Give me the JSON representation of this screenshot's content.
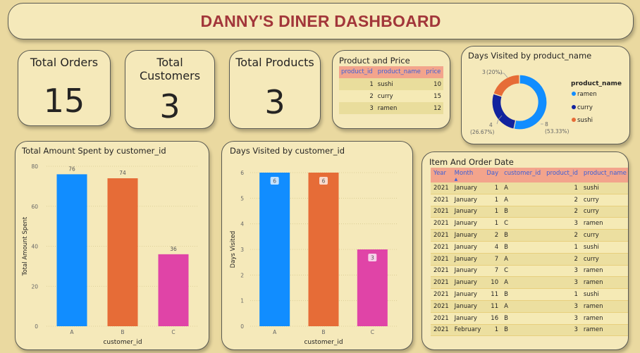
{
  "title": "DANNY'S DINER DASHBOARD",
  "kpis": {
    "orders": {
      "label": "Total Orders",
      "value": "15"
    },
    "customers": {
      "label_line1": "Total",
      "label_line2": "Customers",
      "value": "3"
    },
    "products": {
      "label": "Total Products",
      "value": "3"
    }
  },
  "product_price": {
    "title": "Product and Price",
    "headers": [
      "product_id",
      "product_name",
      "price"
    ],
    "rows": [
      [
        "1",
        "sushi",
        "10"
      ],
      [
        "2",
        "curry",
        "15"
      ],
      [
        "3",
        "ramen",
        "12"
      ]
    ]
  },
  "donut": {
    "title": "Days Visited by product_name",
    "legend_title": "product_name",
    "labels": {
      "ramen": {
        "count": "8",
        "pct": "(53.33%)"
      },
      "curry": {
        "count": "4",
        "pct": "(26.67%)"
      },
      "sushi": {
        "count": "3",
        "pct": "(20%)"
      }
    }
  },
  "colors": {
    "blue": "#118dff",
    "orange": "#e66c37",
    "navy": "#12239e",
    "pink": "#e044a7",
    "accent_title": "#a2363a",
    "table_header": "#f3a48c"
  },
  "item_order": {
    "title": "Item And Order Date",
    "headers": [
      "Year",
      "Month",
      "Day",
      "customer_id",
      "product_id",
      "product_name"
    ],
    "rows": [
      [
        "2021",
        "January",
        "1",
        "A",
        "1",
        "sushi"
      ],
      [
        "2021",
        "January",
        "1",
        "A",
        "2",
        "curry"
      ],
      [
        "2021",
        "January",
        "1",
        "B",
        "2",
        "curry"
      ],
      [
        "2021",
        "January",
        "1",
        "C",
        "3",
        "ramen"
      ],
      [
        "2021",
        "January",
        "2",
        "B",
        "2",
        "curry"
      ],
      [
        "2021",
        "January",
        "4",
        "B",
        "1",
        "sushi"
      ],
      [
        "2021",
        "January",
        "7",
        "A",
        "2",
        "curry"
      ],
      [
        "2021",
        "January",
        "7",
        "C",
        "3",
        "ramen"
      ],
      [
        "2021",
        "January",
        "10",
        "A",
        "3",
        "ramen"
      ],
      [
        "2021",
        "January",
        "11",
        "B",
        "1",
        "sushi"
      ],
      [
        "2021",
        "January",
        "11",
        "A",
        "3",
        "ramen"
      ],
      [
        "2021",
        "January",
        "16",
        "B",
        "3",
        "ramen"
      ],
      [
        "2021",
        "February",
        "1",
        "B",
        "3",
        "ramen"
      ]
    ]
  },
  "chart_data": [
    {
      "type": "bar",
      "title": "Total Amount Spent by customer_id",
      "xlabel": "customer_id",
      "ylabel": "Total Amount Spent",
      "categories": [
        "A",
        "B",
        "C"
      ],
      "values": [
        76,
        74,
        36
      ],
      "ylim": [
        0,
        80
      ],
      "yticks": [
        0,
        20,
        40,
        60,
        80
      ],
      "grid": true
    },
    {
      "type": "bar",
      "title": "Days Visited by customer_id",
      "xlabel": "customer_id",
      "ylabel": "Days Visited",
      "categories": [
        "A",
        "B",
        "C"
      ],
      "values": [
        6,
        6,
        3
      ],
      "ylim": [
        0,
        6
      ],
      "yticks": [
        0,
        1,
        2,
        3,
        4,
        5,
        6
      ],
      "grid": true
    },
    {
      "type": "pie",
      "title": "Days Visited by product_name",
      "categories": [
        "ramen",
        "curry",
        "sushi"
      ],
      "values": [
        8,
        4,
        3
      ]
    }
  ]
}
